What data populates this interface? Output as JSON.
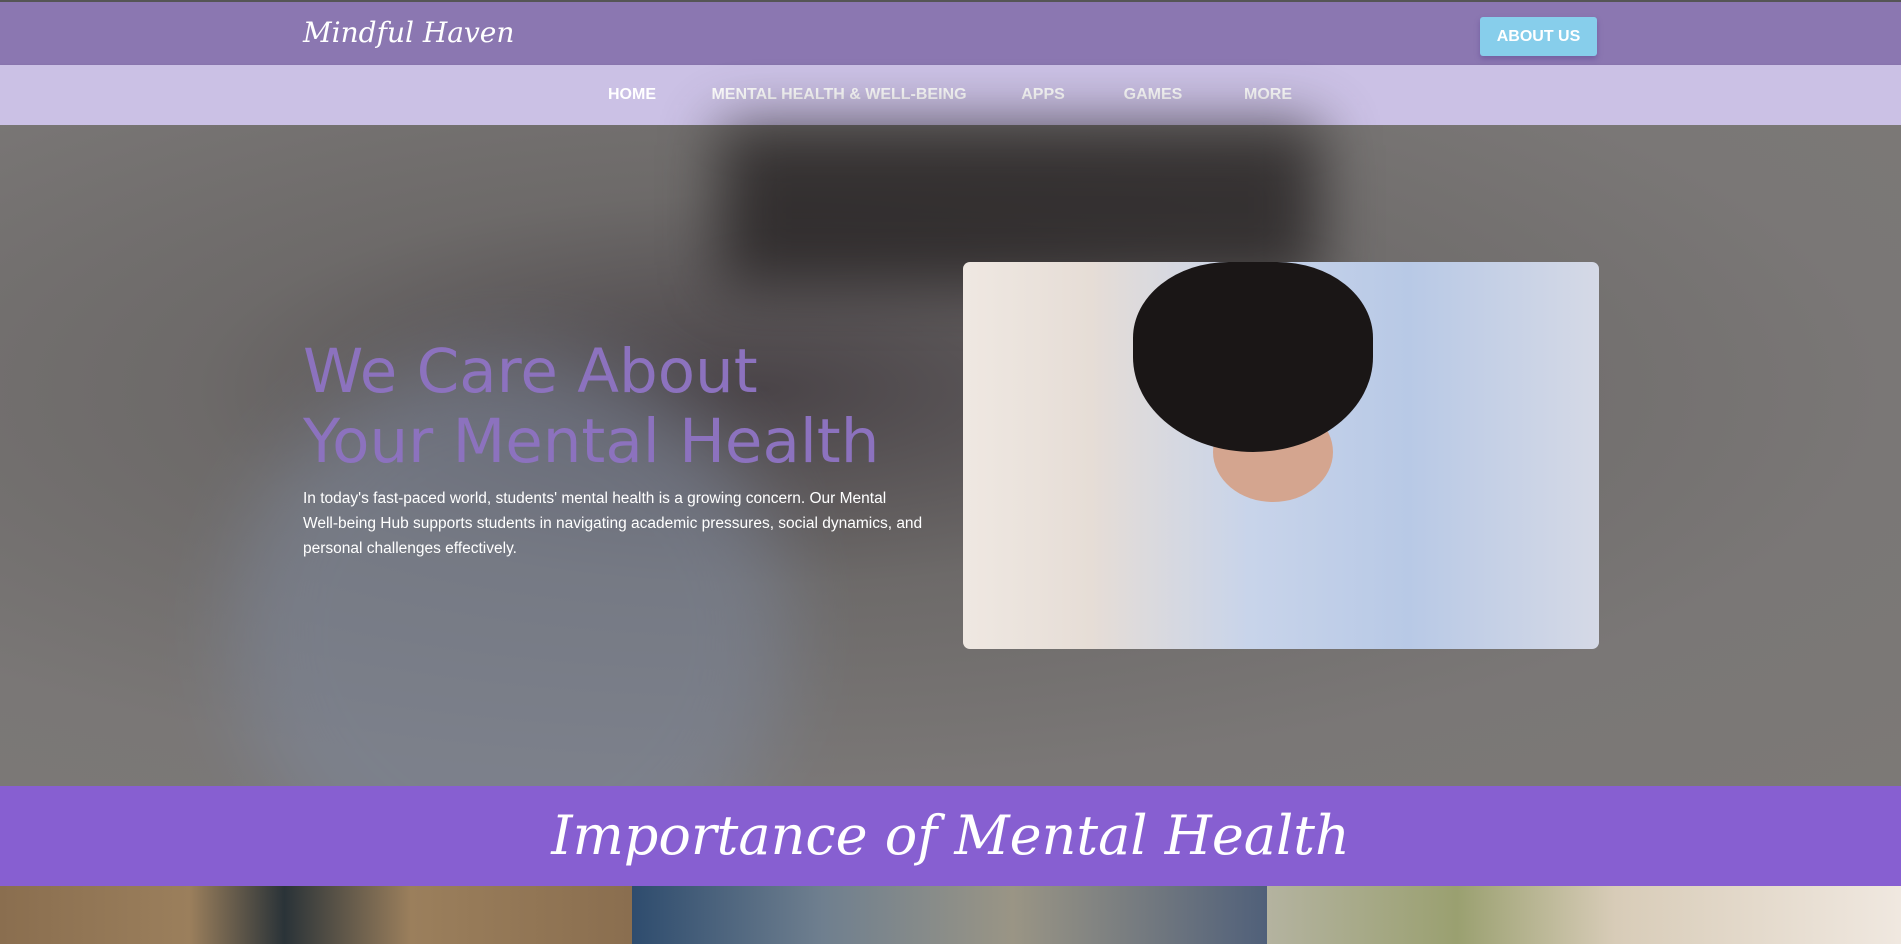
{
  "header": {
    "logo": "Mindful Haven",
    "about_button": "ABOUT US"
  },
  "nav": {
    "items": [
      "HOME",
      "MENTAL HEALTH & WELL-BEING",
      "APPS",
      "GAMES",
      "MORE"
    ]
  },
  "hero": {
    "title_line1": "We Care About",
    "title_line2": "Your Mental Health",
    "text": "In today's fast-paced world, students' mental health is a growing concern. Our Mental Well-being Hub supports students in navigating academic pressures, social dynamics, and personal challenges effectively."
  },
  "section": {
    "title": "Importance of Mental Health"
  },
  "colors": {
    "topbar": "#8b77b1",
    "navbar": "#cbc1e5",
    "accent": "#875fd1",
    "button": "#87ceeb"
  }
}
